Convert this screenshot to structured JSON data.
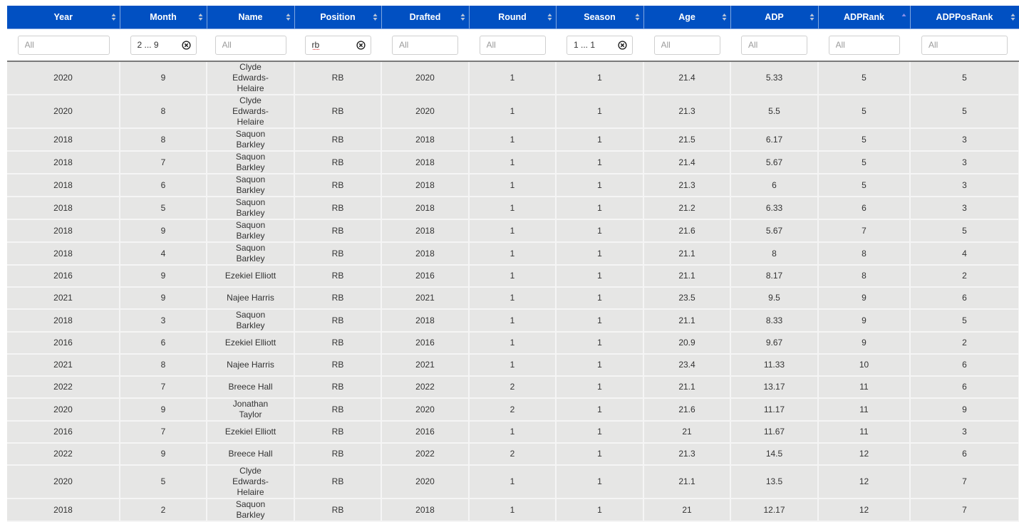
{
  "columns": [
    {
      "label": "Year",
      "sort": "none",
      "filter": {
        "value": "",
        "placeholder": "All",
        "clearable": false
      }
    },
    {
      "label": "Month",
      "sort": "none",
      "filter": {
        "value": "2 ... 9",
        "placeholder": "All",
        "clearable": true
      }
    },
    {
      "label": "Name",
      "sort": "none",
      "filter": {
        "value": "",
        "placeholder": "All",
        "clearable": false
      }
    },
    {
      "label": "Position",
      "sort": "none",
      "filter": {
        "value": "rb",
        "placeholder": "All",
        "clearable": true
      }
    },
    {
      "label": "Drafted",
      "sort": "none",
      "filter": {
        "value": "",
        "placeholder": "All",
        "clearable": false
      }
    },
    {
      "label": "Round",
      "sort": "none",
      "filter": {
        "value": "",
        "placeholder": "All",
        "clearable": false
      }
    },
    {
      "label": "Season",
      "sort": "none",
      "filter": {
        "value": "1 ... 1",
        "placeholder": "All",
        "clearable": true
      }
    },
    {
      "label": "Age",
      "sort": "none",
      "filter": {
        "value": "",
        "placeholder": "All",
        "clearable": false
      }
    },
    {
      "label": "ADP",
      "sort": "none",
      "filter": {
        "value": "",
        "placeholder": "All",
        "clearable": false
      }
    },
    {
      "label": "ADPRank",
      "sort": "ascending",
      "filter": {
        "value": "",
        "placeholder": "All",
        "clearable": false
      }
    },
    {
      "label": "ADPPosRank",
      "sort": "none",
      "filter": {
        "value": "",
        "placeholder": "All",
        "clearable": false
      }
    }
  ],
  "colors": {
    "header_bg": "#0150c2",
    "row_bg": "#e6e6e5",
    "sort_active": "#8a8fe8",
    "sort_inactive": "#b8c4d8"
  },
  "rows": [
    [
      "2020",
      "9",
      "Clyde Edwards-Helaire",
      "RB",
      "2020",
      "1",
      "1",
      "21.4",
      "5.33",
      "5",
      "5"
    ],
    [
      "2020",
      "8",
      "Clyde Edwards-Helaire",
      "RB",
      "2020",
      "1",
      "1",
      "21.3",
      "5.5",
      "5",
      "5"
    ],
    [
      "2018",
      "8",
      "Saquon Barkley",
      "RB",
      "2018",
      "1",
      "1",
      "21.5",
      "6.17",
      "5",
      "3"
    ],
    [
      "2018",
      "7",
      "Saquon Barkley",
      "RB",
      "2018",
      "1",
      "1",
      "21.4",
      "5.67",
      "5",
      "3"
    ],
    [
      "2018",
      "6",
      "Saquon Barkley",
      "RB",
      "2018",
      "1",
      "1",
      "21.3",
      "6",
      "5",
      "3"
    ],
    [
      "2018",
      "5",
      "Saquon Barkley",
      "RB",
      "2018",
      "1",
      "1",
      "21.2",
      "6.33",
      "6",
      "3"
    ],
    [
      "2018",
      "9",
      "Saquon Barkley",
      "RB",
      "2018",
      "1",
      "1",
      "21.6",
      "5.67",
      "7",
      "5"
    ],
    [
      "2018",
      "4",
      "Saquon Barkley",
      "RB",
      "2018",
      "1",
      "1",
      "21.1",
      "8",
      "8",
      "4"
    ],
    [
      "2016",
      "9",
      "Ezekiel Elliott",
      "RB",
      "2016",
      "1",
      "1",
      "21.1",
      "8.17",
      "8",
      "2"
    ],
    [
      "2021",
      "9",
      "Najee Harris",
      "RB",
      "2021",
      "1",
      "1",
      "23.5",
      "9.5",
      "9",
      "6"
    ],
    [
      "2018",
      "3",
      "Saquon Barkley",
      "RB",
      "2018",
      "1",
      "1",
      "21.1",
      "8.33",
      "9",
      "5"
    ],
    [
      "2016",
      "6",
      "Ezekiel Elliott",
      "RB",
      "2016",
      "1",
      "1",
      "20.9",
      "9.67",
      "9",
      "2"
    ],
    [
      "2021",
      "8",
      "Najee Harris",
      "RB",
      "2021",
      "1",
      "1",
      "23.4",
      "11.33",
      "10",
      "6"
    ],
    [
      "2022",
      "7",
      "Breece Hall",
      "RB",
      "2022",
      "2",
      "1",
      "21.1",
      "13.17",
      "11",
      "6"
    ],
    [
      "2020",
      "9",
      "Jonathan Taylor",
      "RB",
      "2020",
      "2",
      "1",
      "21.6",
      "11.17",
      "11",
      "9"
    ],
    [
      "2016",
      "7",
      "Ezekiel Elliott",
      "RB",
      "2016",
      "1",
      "1",
      "21",
      "11.67",
      "11",
      "3"
    ],
    [
      "2022",
      "9",
      "Breece Hall",
      "RB",
      "2022",
      "2",
      "1",
      "21.3",
      "14.5",
      "12",
      "6"
    ],
    [
      "2020",
      "5",
      "Clyde Edwards-Helaire",
      "RB",
      "2020",
      "1",
      "1",
      "21.1",
      "13.5",
      "12",
      "7"
    ],
    [
      "2018",
      "2",
      "Saquon Barkley",
      "RB",
      "2018",
      "1",
      "1",
      "21",
      "12.17",
      "12",
      "7"
    ]
  ]
}
